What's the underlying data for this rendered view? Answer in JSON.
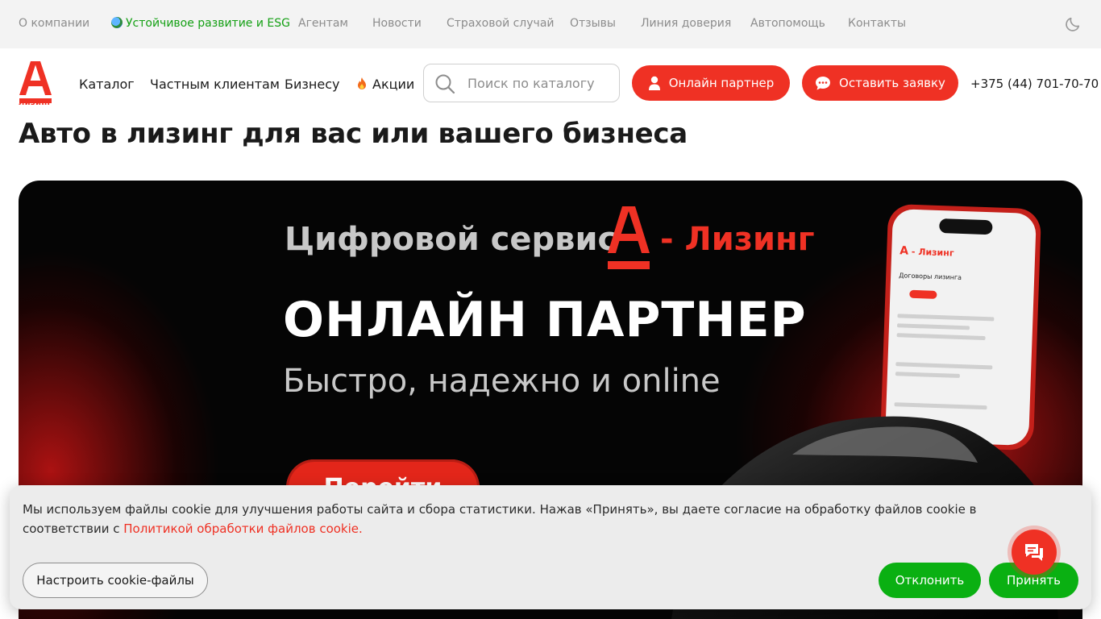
{
  "topbar": {
    "links": [
      {
        "label": "О компании"
      },
      {
        "label": "Устойчивое развитие и ESG"
      },
      {
        "label": "Агентам"
      },
      {
        "label": "Новости"
      },
      {
        "label": "Страховой случай"
      },
      {
        "label": "Отзывы"
      },
      {
        "label": "Линия доверия"
      },
      {
        "label": "Автопомощь"
      },
      {
        "label": "Контакты"
      }
    ],
    "theme_toggle_icon": "moon-icon"
  },
  "header": {
    "logo_text": "лизинг",
    "nav": [
      {
        "label": "Каталог"
      },
      {
        "label": "Частным клиентам"
      },
      {
        "label": "Бизнесу"
      },
      {
        "label": "Акции",
        "icon": "fire-icon"
      }
    ],
    "search": {
      "placeholder": "Поиск по каталогу",
      "value": ""
    },
    "online_partner_label": "Онлайн партнер",
    "request_label": "Оставить заявку",
    "phone": "+375 (44) 701-70-70"
  },
  "page": {
    "title": "Авто в лизинг для вас или вашего бизнеса"
  },
  "banner": {
    "line1": "Цифровой сервис",
    "brand": "- Лизинг",
    "line2": "ОНЛАЙН ПАРТНЕР",
    "line3": "Быстро, надежно и online",
    "cta": "Перейти",
    "phone_screen": {
      "brand": "- Лизинг",
      "heading": "Договоры лизинга"
    }
  },
  "cookie": {
    "text": "Мы используем файлы cookie для улучшения работы сайта и сбора статистики. Нажав «Принять», вы даете согласие на обработку файлов cookie в соответствии с ",
    "link": "Политикой обработки файлов cookie",
    "text_end": ".",
    "settings_label": "Настроить cookie-файлы",
    "decline_label": "Отклонить",
    "accept_label": "Принять"
  },
  "colors": {
    "brand_red": "#ef3124",
    "accept_green": "#0ab012",
    "esg_green": "#14a014",
    "topbar_bg": "#f3f3f3"
  },
  "chat_button_icon": "chat-icon"
}
